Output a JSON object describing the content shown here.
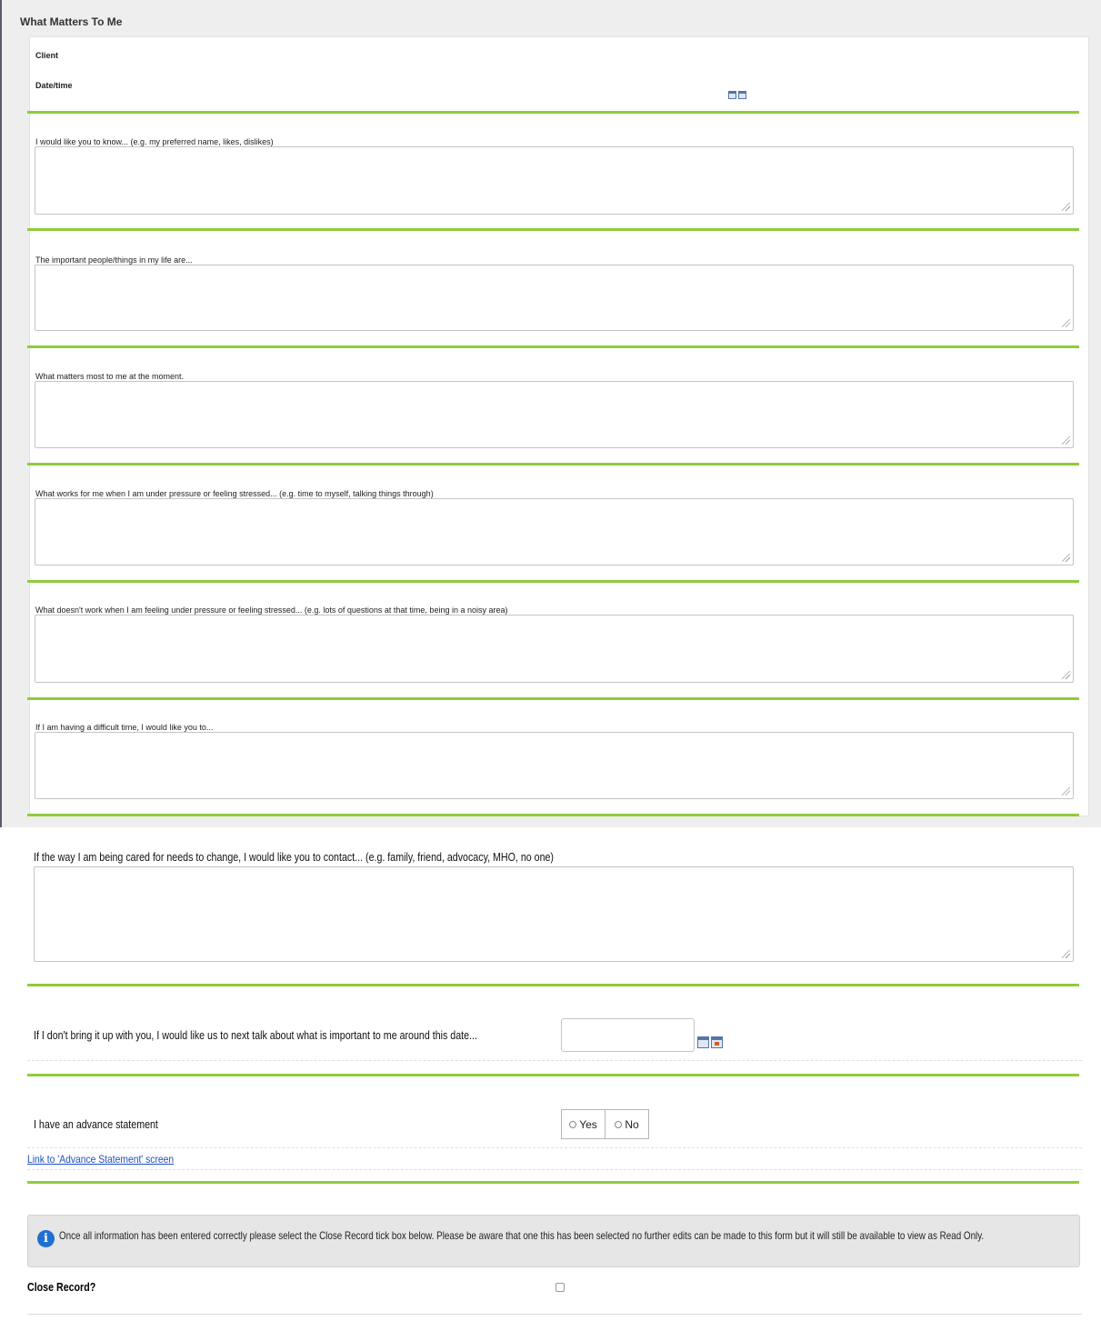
{
  "form": {
    "title": "What Matters To Me",
    "client_label": "Client",
    "datetime_label": "Date/time"
  },
  "questions": {
    "q1": "I would like you to know... (e.g. my preferred name, likes, dislikes)",
    "q2": "The important people/things in my life are...",
    "q3": "What matters most to me at the moment.",
    "q4": "What works for me when I am under pressure or feeling stressed... (e.g. time to myself, talking things through)",
    "q5": "What doesn't work when I am feeling under pressure or feeling stressed... (e.g. lots of questions at that time, being in a noisy area)",
    "q6": "If I am having a difficult time, I would like you to...",
    "q7": "If the way I am being cared for needs to change, I would like you to contact... (e.g. family, friend, advocacy, MHO, no one)",
    "q8": "If I don't bring it up with you, I would like us to next talk about what is important to me around this date..."
  },
  "advance": {
    "label": "I have an advance statement",
    "yes": "Yes",
    "no": "No",
    "link": "Link to 'Advance Statement' screen"
  },
  "info": {
    "text": "Once all information has been entered correctly please select the Close Record tick box below. Please be aware that one this has been selected no further edits can be made to this form but it will still be available to view as Read Only."
  },
  "close": {
    "label": "Close Record?"
  },
  "colors": {
    "accent_green": "#8fcb3b",
    "info_blue": "#1f6fd1",
    "link_blue": "#1f4fbf"
  }
}
